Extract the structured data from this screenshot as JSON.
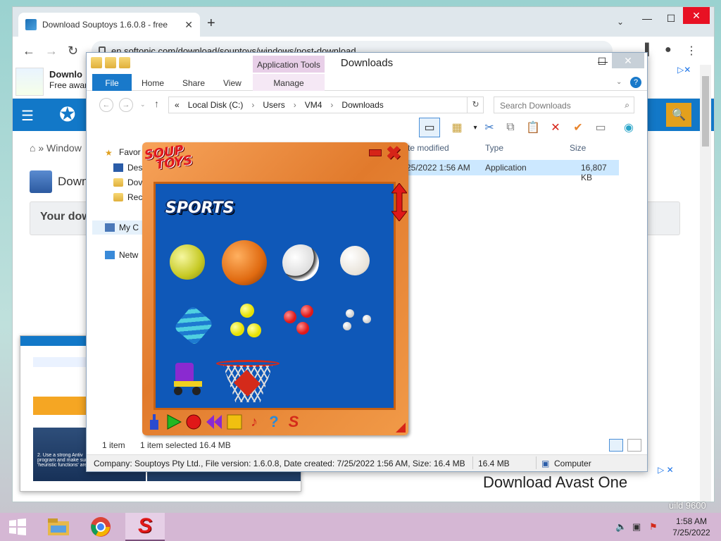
{
  "chrome": {
    "tab_title": "Download Souptoys 1.6.0.8 - free",
    "url": "en.softonic.com/download/souptoys/windows/post-download",
    "ad": {
      "title": "Downlo",
      "subtitle": "Free awar"
    },
    "breadcrumb": "» Window",
    "download_title": "Down",
    "your_download": "Your dow",
    "bottom_ad": "Download Avast One"
  },
  "thumbnail": {
    "caption_line1": "2. Use a strong Antiv",
    "caption_line2": "program and make sure",
    "caption_line3": "'heuristic functions' are activated"
  },
  "explorer": {
    "title": "Downloads",
    "contextual_tab": "Application Tools",
    "ribbon_tabs": [
      "File",
      "Home",
      "Share",
      "View",
      "Manage"
    ],
    "address": {
      "chevron": "«",
      "parts": [
        "Local Disk (C:)",
        "Users",
        "VM4",
        "Downloads"
      ]
    },
    "search_placeholder": "Search Downloads",
    "nav": [
      "Favor",
      "Des",
      "Dov",
      "Rec",
      "My C",
      "Netw"
    ],
    "columns": {
      "date": "te modified",
      "type": "Type",
      "size": "Size"
    },
    "file": {
      "date": "25/2022 1:56 AM",
      "type": "Application",
      "size": "16,807 KB"
    },
    "status": {
      "count": "1 item",
      "selected": "1 item selected  16.4 MB"
    },
    "info": {
      "details": "Company: Souptoys Pty Ltd., File version: 1.6.0.8, Date created: 7/25/2022 1:56 AM, Size: 16.4 MB",
      "size": "16.4 MB",
      "location": "Computer"
    }
  },
  "souptoys": {
    "logo_line1": "SOUP",
    "logo_line2": "TOYS",
    "category": "SPORTS",
    "toys": [
      "tennis-ball",
      "basketball",
      "soccer-ball",
      "baseball",
      "spring-toy",
      "yellow-balls",
      "red-balls",
      "white-balls",
      "roller-skate",
      "basketball-hoop"
    ]
  },
  "taskbar": {
    "time": "1:58 AM",
    "date": "7/25/2022"
  },
  "desktop": {
    "build_text": "uild 9600"
  }
}
